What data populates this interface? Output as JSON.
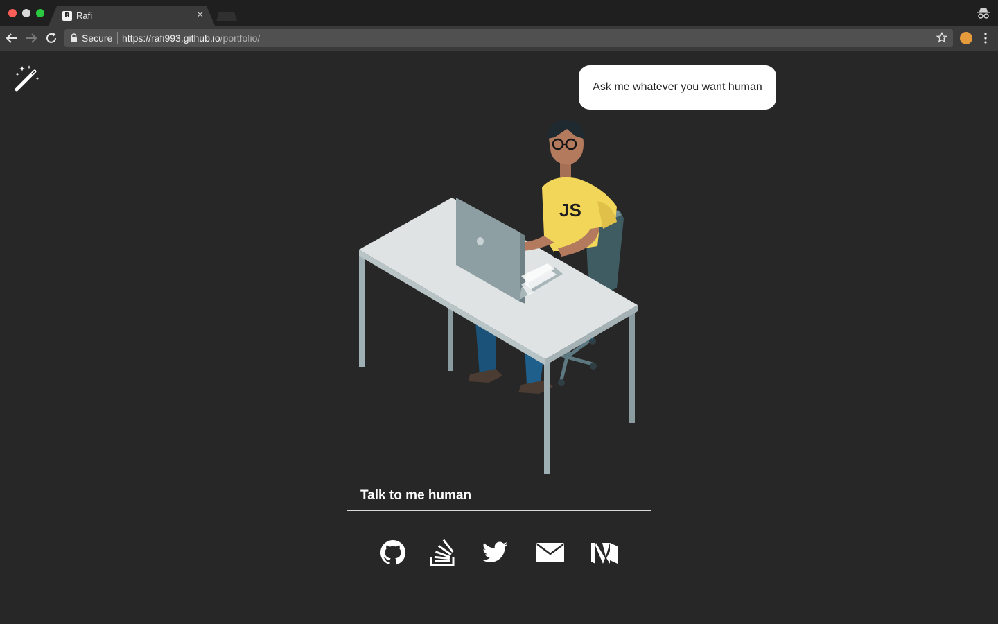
{
  "browser": {
    "tab_title": "Rafi",
    "tab_favicon_letter": "R",
    "tab_close": "×",
    "secure_label": "Secure",
    "url_host": "https://rafi993.github.io",
    "url_path": "/portfolio/"
  },
  "page": {
    "speech_bubble": "Ask me whatever you want human",
    "illustration_shirt_text": "JS",
    "chat_placeholder": "Talk to me human",
    "socials": [
      {
        "icon": "github-icon",
        "label": "GitHub"
      },
      {
        "icon": "stackoverflow-icon",
        "label": "Stack Overflow"
      },
      {
        "icon": "twitter-icon",
        "label": "Twitter"
      },
      {
        "icon": "mail-icon",
        "label": "Email"
      },
      {
        "icon": "medium-icon",
        "label": "Medium"
      }
    ]
  },
  "colors": {
    "page_bg": "#272727",
    "shirt": "#f1d65a",
    "desk": "#dfe3e4",
    "chair": "#4e6b73",
    "pants": "#1e5f8c"
  }
}
